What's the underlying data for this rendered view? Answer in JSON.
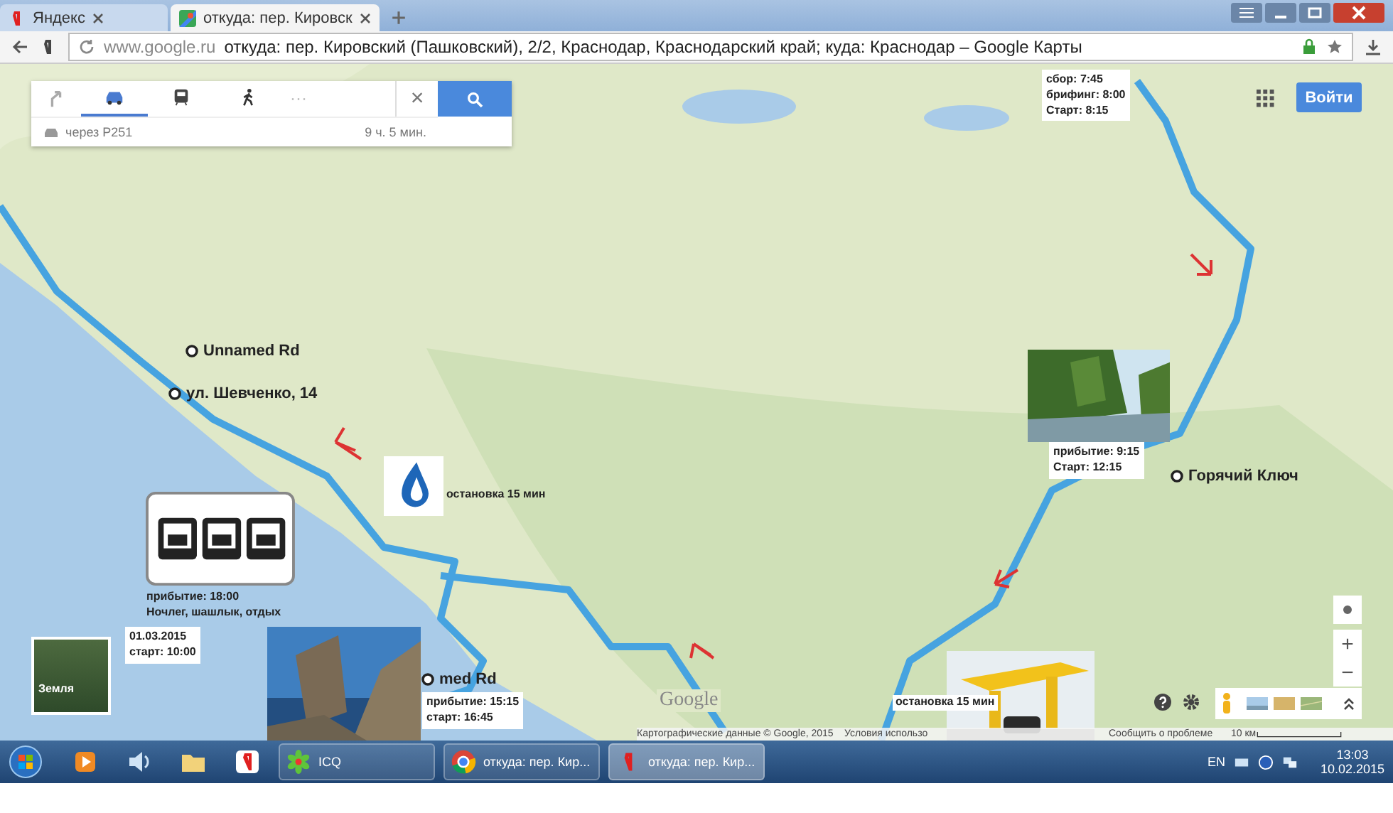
{
  "tabs": [
    {
      "title": "Яндекс",
      "selected": false
    },
    {
      "title": "откуда: пер. Кировск",
      "selected": true
    }
  ],
  "address_bar": {
    "domain": "www.google.ru",
    "title": "откуда: пер. Кировский (Пашковский), 2/2, Краснодар, Краснодарский край; куда: Краснодар – Google Карты"
  },
  "directions": {
    "modes": [
      {
        "kind": "drive",
        "selected": true
      },
      {
        "kind": "transit",
        "selected": false
      },
      {
        "kind": "walk",
        "selected": false
      },
      {
        "kind": "more",
        "selected": false
      }
    ],
    "more_label": "···",
    "close": "×",
    "route": "через Р251",
    "duration": "9 ч. 5 мин."
  },
  "signin": "Войти",
  "waypoints": [
    {
      "label": "Unnamed Rd"
    },
    {
      "label": "ул. Шевченко, 14"
    },
    {
      "label": "Горячий Ключ"
    },
    {
      "label": "med Rd"
    }
  ],
  "notes": [
    {
      "kind": "schedule",
      "lines": [
        "сбор: 7:45",
        "брифинг: 8:00",
        "Старт: 8:15"
      ]
    },
    {
      "kind": "schedule",
      "lines": [
        "прибытие: 18:00",
        "Ночлег, шашлык, отдых"
      ]
    },
    {
      "kind": "schedule",
      "lines": [
        "01.03.2015",
        "старт: 10:00"
      ]
    },
    {
      "kind": "schedule",
      "lines": [
        "прибытие: 15:15",
        "старт: 16:45"
      ]
    },
    {
      "kind": "schedule",
      "lines": [
        "прибытие: 9:15",
        "Старт: 12:15"
      ]
    },
    {
      "kind": "stop",
      "lines": [
        "остановка 15 мин"
      ]
    },
    {
      "kind": "stop",
      "lines": [
        "остановка 15 мин"
      ]
    }
  ],
  "earth_toggle": "Земля",
  "map_logo": "Google",
  "zoom": {
    "in": "+",
    "out": "−"
  },
  "footer": [
    "Картографические данные © Google, 2015",
    "Условия использо",
    "Сообщить о проблеме",
    "10 км"
  ],
  "taskbar": {
    "buttons": [
      {
        "kind": "icq",
        "title": "ICQ",
        "selected": false
      },
      {
        "kind": "chrome",
        "title": "откуда: пер. Кир...",
        "selected": false
      },
      {
        "kind": "yandex",
        "title": "откуда: пер. Кир...",
        "selected": true
      }
    ],
    "lang": "EN",
    "time": "13:03",
    "date": "10.02.2015"
  }
}
